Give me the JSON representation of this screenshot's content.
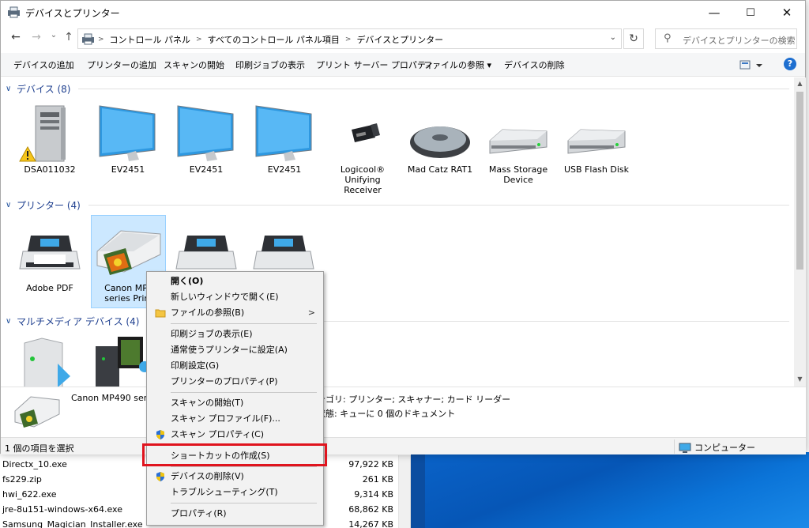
{
  "window": {
    "title": "デバイスとプリンター",
    "minimize": "—",
    "maximize": "☐",
    "close": "✕"
  },
  "address": {
    "crumbs": [
      "コントロール パネル",
      "すべてのコントロール パネル項目",
      "デバイスとプリンター"
    ],
    "search_placeholder": "デバイスとプリンターの検索"
  },
  "toolbar": {
    "items": [
      "デバイスの追加",
      "プリンターの追加",
      "スキャンの開始",
      "印刷ジョブの表示",
      "プリント サーバー プロパティ",
      "ファイルの参照 ▾",
      "デバイスの削除"
    ],
    "help": "?"
  },
  "groups": {
    "devices": {
      "title": "デバイス (8)"
    },
    "printers": {
      "title": "プリンター (4)"
    },
    "multimedia": {
      "title": "マルチメディア デバイス (4)"
    }
  },
  "devices": [
    {
      "label": "DSA011032",
      "icon": "computer-tower-icon"
    },
    {
      "label": "EV2451",
      "icon": "monitor-icon"
    },
    {
      "label": "EV2451",
      "icon": "monitor-icon"
    },
    {
      "label": "EV2451",
      "icon": "monitor-icon"
    },
    {
      "label": "Logicool® Unifying Receiver",
      "icon": "usb-receiver-icon"
    },
    {
      "label": "Mad Catz RAT1",
      "icon": "mouse-icon"
    },
    {
      "label": "Mass Storage Device",
      "icon": "drive-icon"
    },
    {
      "label": "USB Flash Disk",
      "icon": "drive-icon"
    }
  ],
  "printers": [
    {
      "label": "Adobe PDF"
    },
    {
      "label": "Canon MP4 series Print"
    }
  ],
  "details": {
    "name": "Canon MP490 ser",
    "category": "テゴリ: プリンター; スキャナー; カード リーダー",
    "status": "状態: キューに 0 個のドキュメント"
  },
  "status": {
    "left": "1 個の項目を選択",
    "right": "コンピューター"
  },
  "context_menu": {
    "items": [
      {
        "label": "開く(O)",
        "bold": true
      },
      {
        "label": "新しいウィンドウで開く(E)"
      },
      {
        "label": "ファイルの参照(B)",
        "icon": "folder-icon",
        "submenu": true
      },
      {
        "label": "印刷ジョブの表示(E)"
      },
      {
        "label": "通常使うプリンターに設定(A)"
      },
      {
        "label": "印刷設定(G)"
      },
      {
        "label": "プリンターのプロパティ(P)"
      },
      {
        "label": "スキャンの開始(T)"
      },
      {
        "label": "スキャン プロファイル(F)..."
      },
      {
        "label": "スキャン プロパティ(C)",
        "icon": "shield-icon"
      },
      {
        "label": "ショートカットの作成(S)"
      },
      {
        "label": "デバイスの削除(V)",
        "icon": "shield-icon"
      },
      {
        "label": "トラブルシューティング(T)"
      },
      {
        "label": "プロパティ(R)"
      }
    ]
  },
  "background_files": [
    {
      "name": "Directx_10.exe",
      "size": "97,922 KB"
    },
    {
      "name": "fs229.zip",
      "size": "261 KB"
    },
    {
      "name": "hwi_622.exe",
      "size": "9,314 KB"
    },
    {
      "name": "jre-8u151-windows-x64.exe",
      "size": "68,862 KB"
    },
    {
      "name": "Samsung_Magician_Installer.exe",
      "size": "14,267 KB"
    }
  ],
  "colors": {
    "group_title": "#1e3f8f",
    "selection": "#cce8ff",
    "highlight_box": "#e0141e",
    "desktop": "#0656b6"
  }
}
